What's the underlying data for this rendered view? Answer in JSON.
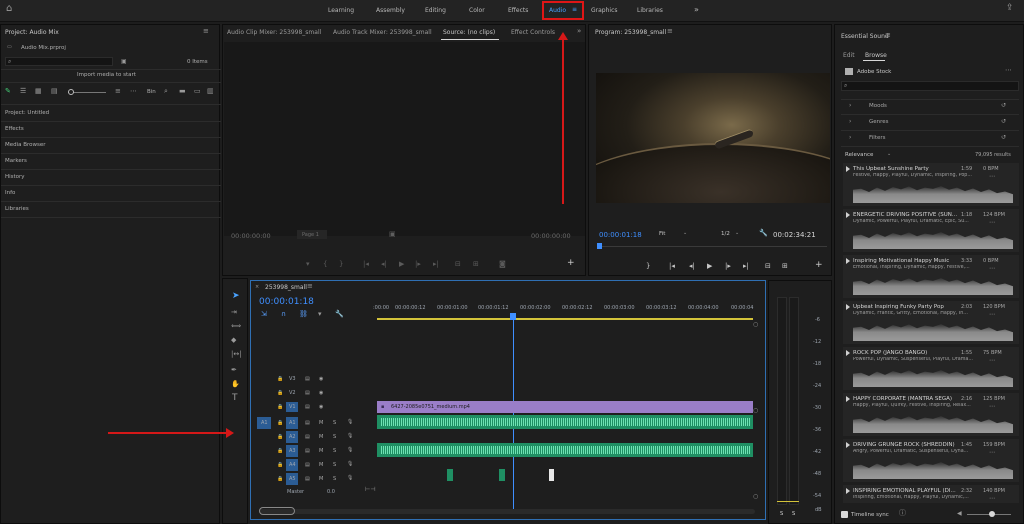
{
  "workspaces": {
    "tabs": [
      "Learning",
      "Assembly",
      "Editing",
      "Color",
      "Effects",
      "Audio",
      "Graphics",
      "Libraries"
    ],
    "active": "Audio",
    "more": "»"
  },
  "project": {
    "title": "Project: Audio Mix",
    "file": "Audio Mix.prproj",
    "item_count": "0 Items",
    "import_hint": "Import media to start",
    "items": [
      "Project: Untitled",
      "Effects",
      "Media Browser",
      "Markers",
      "History",
      "Info",
      "Libraries"
    ],
    "size_label": "Bin"
  },
  "source_panel": {
    "tabs": [
      "Audio Clip Mixer: 253998_small",
      "Audio Track Mixer: 253998_small",
      "Source: (no clips)",
      "Effect Controls"
    ],
    "tc_left": "00:00:00:00",
    "tc_right": "00:00:00:00",
    "page": "Page 1"
  },
  "program": {
    "title": "Program: 253998_small",
    "tc_current": "00:00:01:18",
    "fit": "Fit",
    "quality": "1/2",
    "tc_duration": "00:02:34:21"
  },
  "timeline": {
    "sequence": "253998_small",
    "tc": "00:00:01:18",
    "ruler": [
      ":00:00",
      "00:00:00:12",
      "00:00:01:00",
      "00:00:01:12",
      "00:00:02:00",
      "00:00:02:12",
      "00:00:03:00",
      "00:00:03:12",
      "00:00:04:00",
      "00:00:04"
    ],
    "video_tracks": [
      "V3",
      "V2",
      "V1"
    ],
    "audio_tracks": [
      "A1",
      "A2",
      "A3",
      "A4",
      "A5"
    ],
    "source_patch": "A1",
    "clip_name": "6427-2085e0751_medium.mp4",
    "master_label": "Master",
    "master_value": "0.0",
    "btn_m": "M",
    "btn_s": "S"
  },
  "meter": {
    "ticks": [
      "-6",
      "-12",
      "-18",
      "-24",
      "-30",
      "-36",
      "-42",
      "-48",
      "-54",
      "dB"
    ],
    "solo": [
      "S",
      "S"
    ]
  },
  "essential_sound": {
    "title": "Essential Sound",
    "tabs": [
      "Edit",
      "Browse"
    ],
    "active_tab": "Browse",
    "source": "Adobe Stock",
    "filters": [
      "Moods",
      "Genres",
      "Filters"
    ],
    "sort": "Relevance",
    "results": "79,095 results",
    "timeline_sync": "Timeline sync",
    "tracks": [
      {
        "title": "This Upbeat Sunshine Party",
        "duration": "1:59",
        "bpm": "0 BPM",
        "tags": "Festive, Happy, Playful, Dynamic, Inspiring, Pop..."
      },
      {
        "title": "ENERGETIC DRIVING POSITIVE (SUN...",
        "duration": "1:18",
        "bpm": "124 BPM",
        "tags": "Dynamic, Powerful, Playful, Dramatic, Epic, Su..."
      },
      {
        "title": "Inspiring Motivational Happy Music",
        "duration": "3:33",
        "bpm": "0 BPM",
        "tags": "Emotional, Inspiring, Dynamic, Happy, Festive,..."
      },
      {
        "title": "Upbeat Inspiring Funky Party Pop",
        "duration": "2:03",
        "bpm": "120 BPM",
        "tags": "Dynamic, Frantic, Gritty, Emotional, Happy, In..."
      },
      {
        "title": "ROCK POP (JANGO BANGO)",
        "duration": "1:55",
        "bpm": "75 BPM",
        "tags": "Powerful, Dynamic, Suspenseful, Playful, Drama..."
      },
      {
        "title": "HAPPY CORPORATE (MANTRA SEGA)",
        "duration": "2:16",
        "bpm": "125 BPM",
        "tags": "Happy, Playful, Quirky, Festive, Inspiring, Relax..."
      },
      {
        "title": "DRIVING GRUNGE ROCK (SHREDDIN)",
        "duration": "1:45",
        "bpm": "159 BPM",
        "tags": "Angry, Powerful, Dramatic, Suspenseful, Dyna..."
      },
      {
        "title": "INSPIRING EMOTIONAL PLAYFUL (DI...",
        "duration": "2:32",
        "bpm": "140 BPM",
        "tags": "Inspiring, Emotional, Happy, Playful, Dynamic,..."
      }
    ]
  },
  "colors": {
    "accent": "#3f8fff",
    "highlight_box": "#e01616",
    "clip_video": "#9a7ec8",
    "clip_audio": "#1f8f63"
  }
}
